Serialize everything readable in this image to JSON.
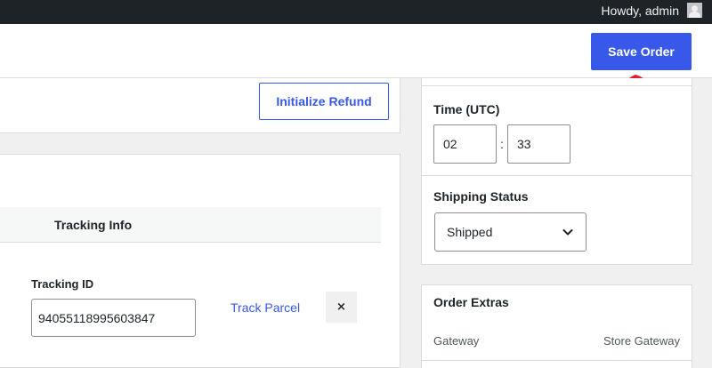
{
  "admin_bar": {
    "greeting": "Howdy, admin"
  },
  "header": {
    "save_label": "Save Order"
  },
  "refund": {
    "button_label": "Initialize Refund"
  },
  "schedule": {
    "time_label": "Time (UTC)",
    "hour": "02",
    "separator": ":",
    "minute": "33"
  },
  "shipping": {
    "label": "Shipping Status",
    "selected": "Shipped"
  },
  "tracking": {
    "header": "Tracking Info",
    "id_label": "Tracking ID",
    "id_value": "94055118995603847",
    "track_link": "Track Parcel",
    "remove_symbol": "×"
  },
  "extras": {
    "title": "Order Extras",
    "gateway_label": "Gateway",
    "gateway_value": "Store Gateway"
  },
  "colors": {
    "accent": "#3858e9",
    "annotation": "#e0202a",
    "admin_bar": "#1d2327"
  },
  "icons": [
    "user-avatar-icon",
    "chevron-down-icon",
    "close-icon",
    "hand-drawn-arrow"
  ]
}
